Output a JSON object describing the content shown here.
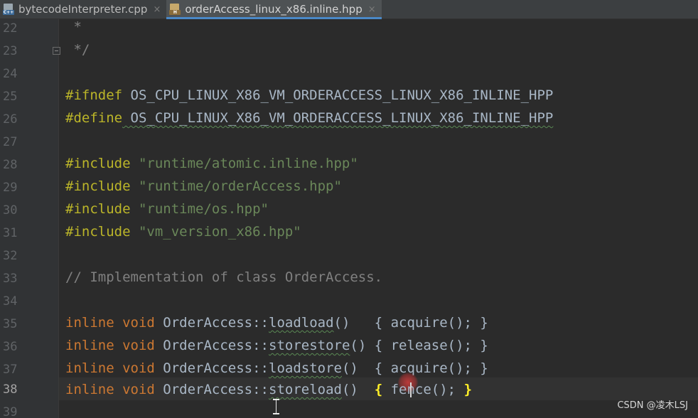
{
  "tabs": [
    {
      "label": "bytecodeInterpreter.cpp",
      "icon": "cpp-file-icon",
      "badge": "C++",
      "active": false
    },
    {
      "label": "orderAccess_linux_x86.inline.hpp",
      "icon": "header-file-icon",
      "badge": "H",
      "active": true
    }
  ],
  "tab_close_glyph": "×",
  "line_numbers": [
    "22",
    "23",
    "24",
    "25",
    "26",
    "27",
    "28",
    "29",
    "30",
    "31",
    "32",
    "33",
    "34",
    "35",
    "36",
    "37",
    "38",
    "39"
  ],
  "code": {
    "l22": " *",
    "l23": " */",
    "l25_kw": "#ifndef",
    "l25_rest": " OS_CPU_LINUX_X86_VM_ORDERACCESS_LINUX_X86_INLINE_HPP",
    "l26_kw": "#define",
    "l26_rest": " OS_CPU_LINUX_X86_VM_ORDERACCESS_LINUX_X86_INLINE_HPP",
    "l28_kw": "#include",
    "l28_str": " \"runtime/atomic.inline.hpp\"",
    "l29_kw": "#include",
    "l29_str": " \"runtime/orderAccess.hpp\"",
    "l30_kw": "#include",
    "l30_str": " \"runtime/os.hpp\"",
    "l31_kw": "#include",
    "l31_str": " \"vm_version_x86.hpp\"",
    "l33": "// Implementation of class OrderAccess.",
    "inline_void": "inline void",
    "class_prefix": " OrderAccess::",
    "l35_fn": "loadload",
    "l35_rest": "()   { acquire(); }",
    "l36_fn": "storestore",
    "l36_rest": "() { release(); }",
    "l37_fn": "loadstore",
    "l37_rest": "()  { acquire(); }",
    "l38_fn": "storeload",
    "l38_mid": "()  ",
    "l38_open": "{",
    "l38_body": " fence(); ",
    "l38_close": "}"
  },
  "watermark": "CSDN @凌木LSJ",
  "colors": {
    "editor_bg": "#2b2b2b",
    "keyword": "#cc7832",
    "preprocessor": "#bbb529",
    "string": "#6a8759",
    "comment": "#808080",
    "text": "#a9b7c6",
    "brace_match": "#ffef28"
  }
}
